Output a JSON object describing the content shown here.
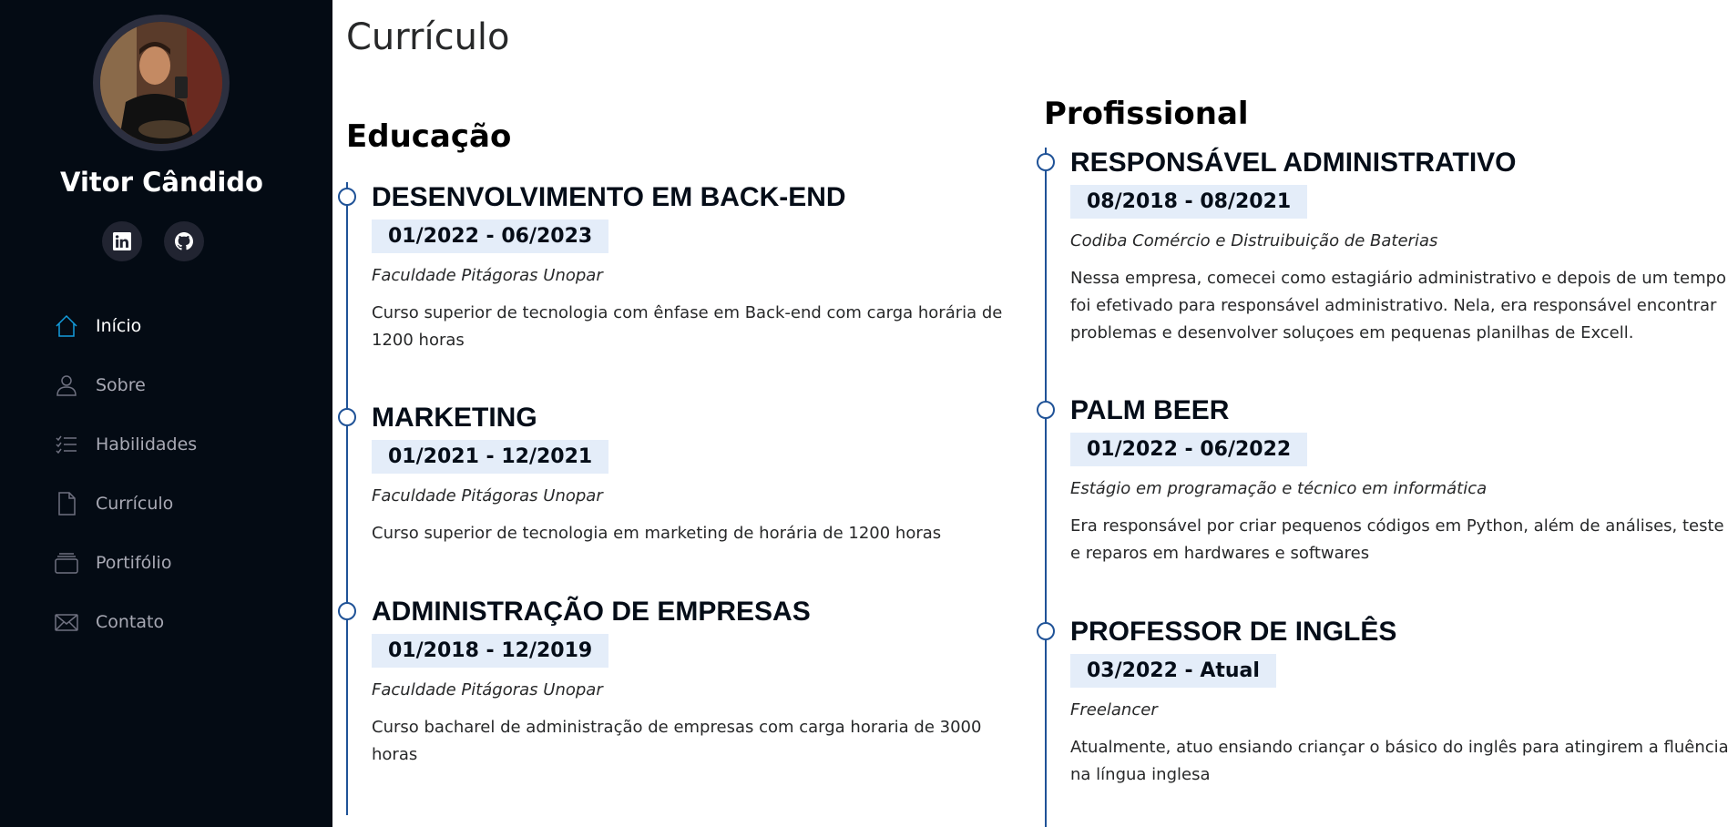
{
  "profile": {
    "name": "Vitor Cândido",
    "avatar_alt": "profile-photo"
  },
  "social": {
    "linkedin_icon": "linkedin-icon",
    "github_icon": "github-icon"
  },
  "nav": {
    "items": [
      {
        "label": "Início",
        "icon": "home-icon",
        "active": true
      },
      {
        "label": "Sobre",
        "icon": "person-icon",
        "active": false
      },
      {
        "label": "Habilidades",
        "icon": "list-icon",
        "active": false
      },
      {
        "label": "Currículo",
        "icon": "file-icon",
        "active": false
      },
      {
        "label": "Portifólio",
        "icon": "stack-icon",
        "active": false
      },
      {
        "label": "Contato",
        "icon": "envelope-icon",
        "active": false
      }
    ]
  },
  "colors": {
    "sidebar_bg": "#040b14",
    "accent": "#149ddd",
    "timeline": "#1f5297",
    "date_bg": "#e4edf9"
  },
  "main": {
    "title": "Currículo",
    "education": {
      "title": "Educação",
      "items": [
        {
          "title": "DESENVOLVIMENTO EM BACK-END",
          "date": "01/2022 - 06/2023",
          "org": "Faculdade Pitágoras Unopar",
          "desc": "Curso superior de tecnologia com ênfase em Back-end com carga horária de 1200 horas"
        },
        {
          "title": "MARKETING",
          "date": "01/2021 - 12/2021",
          "org": "Faculdade Pitágoras Unopar",
          "desc": "Curso superior de tecnologia em marketing de horária de 1200 horas"
        },
        {
          "title": "ADMINISTRAÇÃO DE EMPRESAS",
          "date": "01/2018 - 12/2019",
          "org": "Faculdade Pitágoras Unopar",
          "desc": "Curso bacharel de administração de empresas com carga horaria de 3000 horas"
        }
      ]
    },
    "professional": {
      "title": "Profissional",
      "items": [
        {
          "title": "RESPONSÁVEL ADMINISTRATIVO",
          "date": "08/2018 - 08/2021",
          "org": "Codiba Comércio e Distruibuição de Baterias",
          "desc": "Nessa empresa, comecei como estagiário administrativo e depois de um tempo foi efetivado para responsável administrativo. Nela, era responsável encontrar problemas e desenvolver soluçoes em pequenas planilhas de Excell."
        },
        {
          "title": "PALM BEER",
          "date": "01/2022 - 06/2022",
          "org": "Estágio em programação e técnico em informática",
          "desc": "Era responsável por criar pequenos códigos em Python, além de análises, teste e reparos em hardwares e softwares"
        },
        {
          "title": "PROFESSOR DE INGLÊS",
          "date": "03/2022 - Atual",
          "org": "Freelancer",
          "desc": "Atualmente, atuo ensiando criançar o básico do inglês para atingirem a fluência na língua inglesa"
        }
      ]
    }
  }
}
